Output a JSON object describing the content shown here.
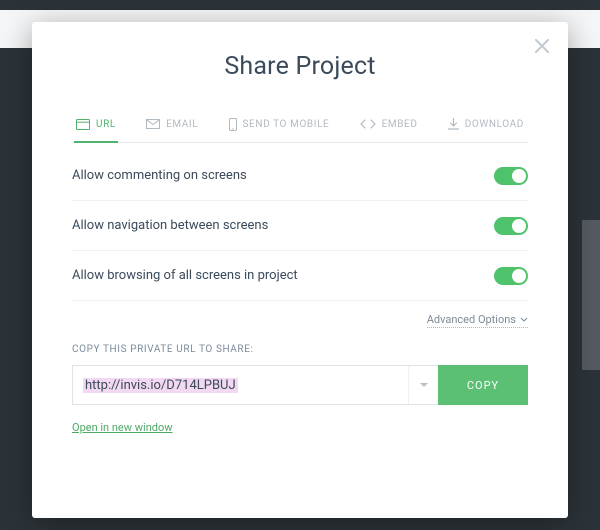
{
  "modal": {
    "title": "Share Project"
  },
  "tabs": {
    "url": "URL",
    "email": "EMAIL",
    "mobile": "SEND TO MOBILE",
    "embed": "EMBED",
    "download": "DOWNLOAD"
  },
  "options": {
    "commenting": {
      "label": "Allow commenting on screens",
      "on": true
    },
    "navigation": {
      "label": "Allow navigation between screens",
      "on": true
    },
    "browsing": {
      "label": "Allow browsing of all screens in project",
      "on": true
    }
  },
  "advanced": {
    "label": "Advanced Options"
  },
  "share": {
    "caption": "COPY THIS PRIVATE URL TO SHARE:",
    "url": "http://invis.io/D714LPBUJ",
    "copy_label": "COPY",
    "open_label": "Open in new window"
  }
}
